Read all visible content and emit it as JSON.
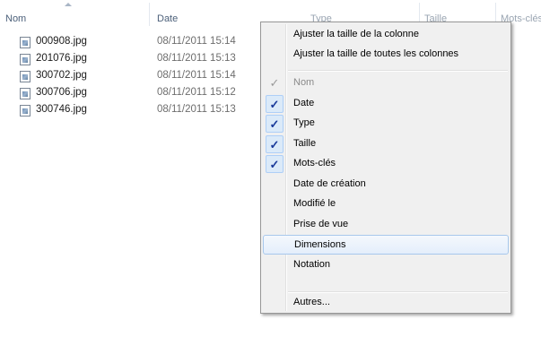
{
  "columns": {
    "name": "Nom",
    "date": "Date",
    "type": "Type",
    "size": "Taille",
    "keywords": "Mots-clés"
  },
  "files": [
    {
      "name": "000908.jpg",
      "date": "08/11/2011 15:14",
      "icon": "image-file-icon"
    },
    {
      "name": "201076.jpg",
      "date": "08/11/2011 15:13",
      "icon": "image-file-icon"
    },
    {
      "name": "300702.jpg",
      "date": "08/11/2011 15:14",
      "icon": "image-file-icon"
    },
    {
      "name": "300706.jpg",
      "date": "08/11/2011 15:12",
      "icon": "image-file-icon"
    },
    {
      "name": "300746.jpg",
      "date": "08/11/2011 15:13",
      "icon": "image-file-icon"
    }
  ],
  "menu": {
    "size_column": "Ajuster la taille de la colonne",
    "size_all_columns": "Ajuster la taille de toutes les colonnes",
    "items": [
      {
        "label": "Nom",
        "checked": true,
        "disabled": true
      },
      {
        "label": "Date",
        "checked": true
      },
      {
        "label": "Type",
        "checked": true
      },
      {
        "label": "Taille",
        "checked": true
      },
      {
        "label": "Mots-clés",
        "checked": true
      },
      {
        "label": "Date de création",
        "checked": false
      },
      {
        "label": "Modifié le",
        "checked": false
      },
      {
        "label": "Prise de vue",
        "checked": false
      },
      {
        "label": "Dimensions",
        "checked": false,
        "highlighted": true
      },
      {
        "label": "Notation",
        "checked": false
      }
    ],
    "more": "Autres...",
    "check_glyph": "✓"
  },
  "colors": {
    "header_text": "#4c607a",
    "checkmark": "#1a3a9a",
    "highlight_border": "#a8c8ec"
  }
}
